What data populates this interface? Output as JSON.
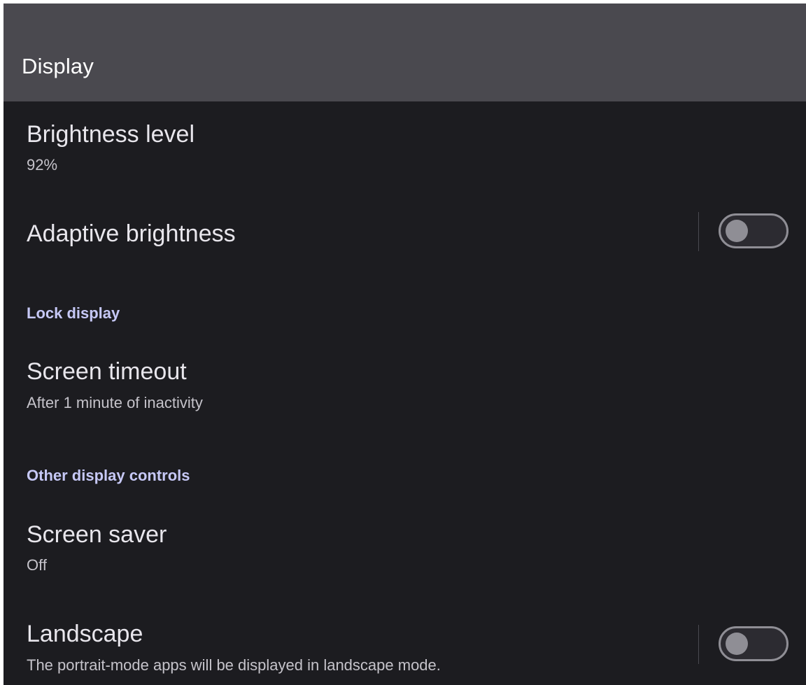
{
  "app_bar": {
    "title": "Display"
  },
  "preferences": {
    "brightness": {
      "title": "Brightness level",
      "summary": "92%"
    },
    "adaptive_brightness": {
      "title": "Adaptive brightness",
      "switch_on": false
    },
    "lock_display_header": "Lock display",
    "screen_timeout": {
      "title": "Screen timeout",
      "summary": "After 1 minute of inactivity"
    },
    "other_controls_header": "Other display controls",
    "screen_saver": {
      "title": "Screen saver",
      "summary": "Off"
    },
    "landscape": {
      "title": "Landscape",
      "summary": "The portrait-mode apps will be displayed in landscape mode.",
      "switch_on": false
    }
  },
  "colors": {
    "app_bar_bg": "#4a494f",
    "background": "#1c1c20",
    "category_accent": "#c6c8f6",
    "switch_off": "#8f8e95"
  }
}
